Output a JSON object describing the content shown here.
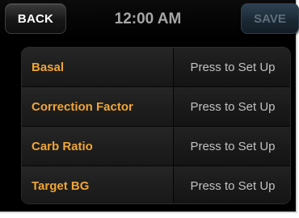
{
  "header": {
    "back_label": "BACK",
    "time": "12:00 AM",
    "save_label": "SAVE"
  },
  "settings": [
    {
      "label": "Basal",
      "value": "Press to Set Up"
    },
    {
      "label": "Correction Factor",
      "value": "Press to Set Up"
    },
    {
      "label": "Carb Ratio",
      "value": "Press to Set Up"
    },
    {
      "label": "Target BG",
      "value": "Press to Set Up"
    }
  ],
  "colors": {
    "label_accent": "#f0a535",
    "value_text": "#c2c2c2",
    "time_text": "#a6a6a6",
    "save_disabled_text": "#5e6f7d"
  }
}
